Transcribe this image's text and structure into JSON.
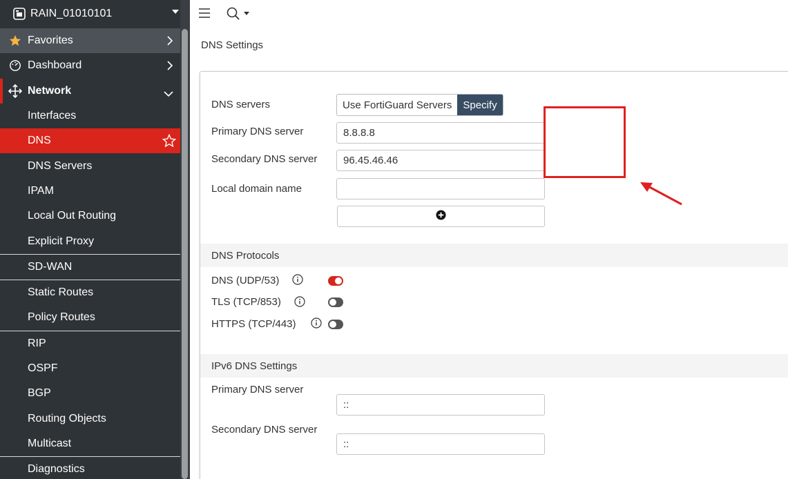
{
  "device": {
    "name": "RAIN_01010101"
  },
  "sidebar": {
    "favorites": "Favorites",
    "dashboard": "Dashboard",
    "network": "Network",
    "items": [
      {
        "label": "Interfaces"
      },
      {
        "label": "DNS"
      },
      {
        "label": "DNS Servers"
      },
      {
        "label": "IPAM"
      },
      {
        "label": "Local Out Routing"
      },
      {
        "label": "Explicit Proxy"
      },
      {
        "label": "SD-WAN"
      },
      {
        "label": "Static Routes"
      },
      {
        "label": "Policy Routes"
      },
      {
        "label": "RIP"
      },
      {
        "label": "OSPF"
      },
      {
        "label": "BGP"
      },
      {
        "label": "Routing Objects"
      },
      {
        "label": "Multicast"
      },
      {
        "label": "Diagnostics"
      }
    ]
  },
  "page": {
    "title": "DNS Settings"
  },
  "dns": {
    "servers_label": "DNS servers",
    "opt_fortiguard": "Use FortiGuard Servers",
    "opt_specify": "Specify",
    "primary_label": "Primary DNS server",
    "primary_value": "8.8.8.8",
    "secondary_label": "Secondary DNS server",
    "secondary_value": "96.45.46.46",
    "local_domain_label": "Local domain name",
    "local_domain_value": ""
  },
  "protocols": {
    "heading": "DNS Protocols",
    "udp": {
      "label": "DNS (UDP/53)",
      "enabled": true
    },
    "tls": {
      "label": "TLS (TCP/853)",
      "enabled": false
    },
    "https": {
      "label": "HTTPS (TCP/443)",
      "enabled": false
    }
  },
  "ipv6": {
    "heading": "IPv6 DNS Settings",
    "primary_label": "Primary DNS server",
    "primary_value": "::",
    "secondary_label": "Secondary DNS server",
    "secondary_value": "::"
  },
  "colors": {
    "sidebar_bg": "#2e3337",
    "active": "#d9251c",
    "segment_selected": "#384c63",
    "annotation": "#e02020"
  }
}
